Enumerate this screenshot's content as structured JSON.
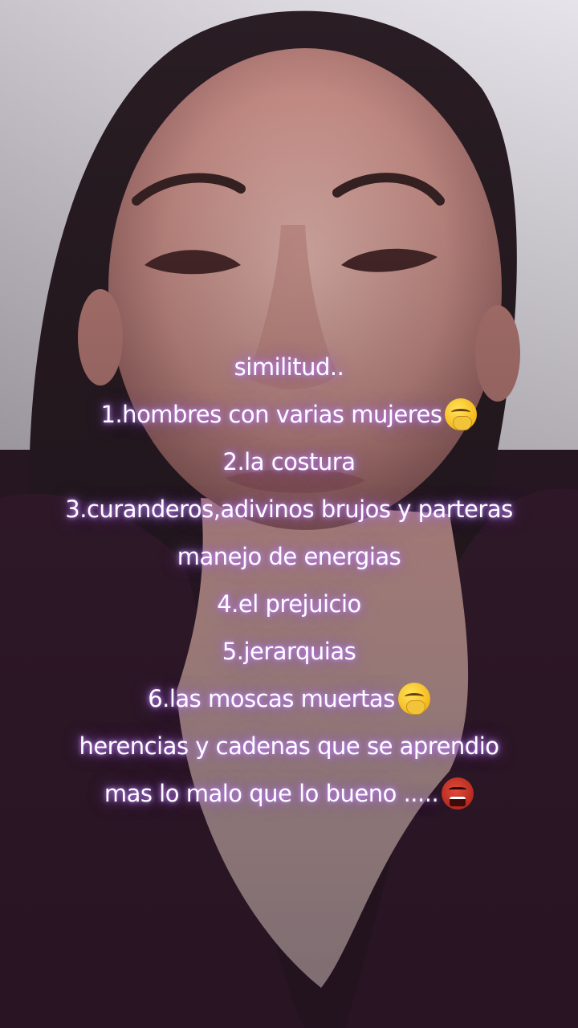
{
  "overlay": {
    "lines": [
      "similitud..",
      "1.hombres con varias mujeres",
      "2.la costura",
      "3.curanderos,adivinos brujos y parteras",
      "manejo de energias",
      "4.el prejuicio",
      "5.jerarquias",
      "6.las moscas muertas",
      "herencias y cadenas que se aprendio",
      "mas lo malo que lo bueno ....."
    ],
    "emojis": {
      "line1": "face-with-hand-over-mouth-icon",
      "line7": "face-with-hand-over-mouth-icon",
      "line9": "ogre-icon"
    },
    "glow_color": "#b070ff"
  }
}
